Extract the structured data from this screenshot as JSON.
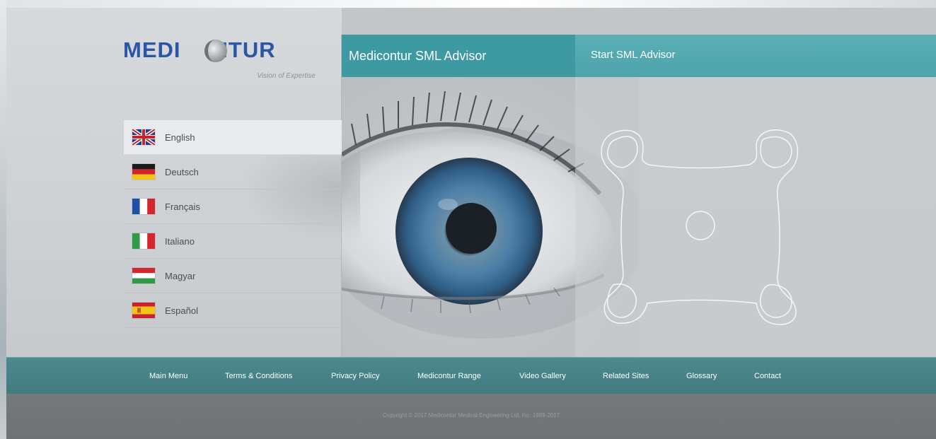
{
  "brand": {
    "logo_left": "MEDI",
    "logo_right": "NTUR",
    "tagline": "Vision of Expertise",
    "logo_color": "#2b55a5"
  },
  "header": {
    "advisor_title": "Medicontur SML Advisor",
    "start_label": "Start SML Advisor",
    "accent": "#3d9aa2"
  },
  "languages": [
    {
      "label": "English",
      "flag": "uk-flag-icon",
      "active": true
    },
    {
      "label": "Deutsch",
      "flag": "germany-flag-icon",
      "active": false
    },
    {
      "label": "Français",
      "flag": "france-flag-icon",
      "active": false
    },
    {
      "label": "Italiano",
      "flag": "italy-flag-icon",
      "active": false
    },
    {
      "label": "Magyar",
      "flag": "hungary-flag-icon",
      "active": false
    },
    {
      "label": "Español",
      "flag": "spain-flag-icon",
      "active": false
    }
  ],
  "footer": {
    "links": [
      "Main Menu",
      "Terms & Conditions",
      "Privacy Policy",
      "Medicontur Range",
      "Video Gallery",
      "Related Sites",
      "Glossary",
      "Contact"
    ],
    "copyright": "Copyright © 2017 Medicontur Medical Engineering Ltd, Inc. 1989-2017"
  }
}
